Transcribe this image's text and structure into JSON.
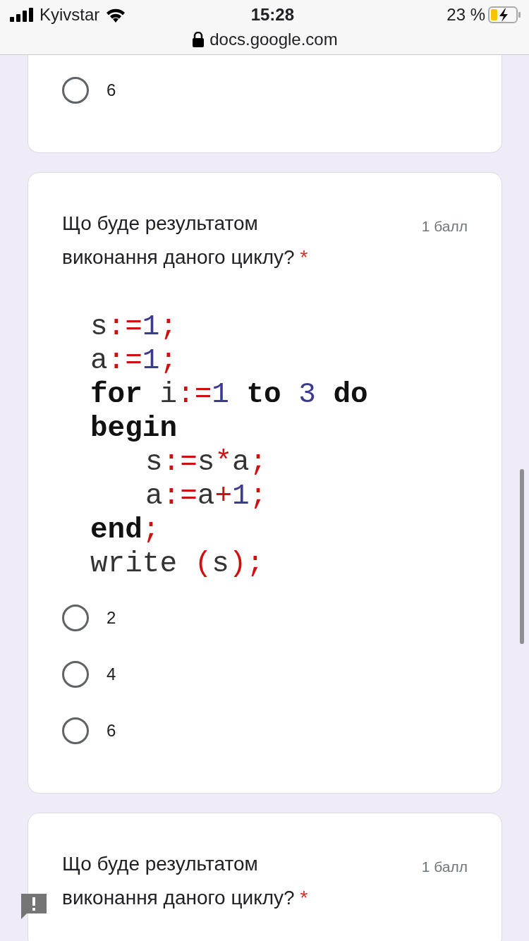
{
  "status_bar": {
    "carrier": "Kyivstar",
    "time": "15:28",
    "battery": "23 %",
    "url": "docs.google.com"
  },
  "questions": [
    {
      "options": [
        {
          "label": "6",
          "selected": false
        }
      ]
    },
    {
      "title": "Що буде результатом виконання даного циклу?",
      "required_mark": "*",
      "points": "1 балл",
      "code": [
        {
          "indented": false,
          "tokens": [
            {
              "kind": "id",
              "text": "s"
            },
            {
              "kind": "op",
              "text": ":="
            },
            {
              "kind": "num",
              "text": "1"
            },
            {
              "kind": "op",
              "text": ";"
            }
          ]
        },
        {
          "indented": false,
          "tokens": [
            {
              "kind": "id",
              "text": "a"
            },
            {
              "kind": "op",
              "text": ":="
            },
            {
              "kind": "num",
              "text": "1"
            },
            {
              "kind": "op",
              "text": ";"
            }
          ]
        },
        {
          "indented": false,
          "tokens": [
            {
              "kind": "kw",
              "text": "for"
            },
            {
              "kind": "id",
              "text": " i"
            },
            {
              "kind": "op",
              "text": ":="
            },
            {
              "kind": "num",
              "text": "1"
            },
            {
              "kind": "kw",
              "text": " to "
            },
            {
              "kind": "num",
              "text": "3"
            },
            {
              "kind": "kw",
              "text": " do"
            }
          ]
        },
        {
          "indented": false,
          "tokens": [
            {
              "kind": "kw",
              "text": "begin"
            }
          ]
        },
        {
          "indented": true,
          "tokens": [
            {
              "kind": "id",
              "text": "s"
            },
            {
              "kind": "op",
              "text": ":="
            },
            {
              "kind": "id",
              "text": "s"
            },
            {
              "kind": "op",
              "text": "*"
            },
            {
              "kind": "id",
              "text": "a"
            },
            {
              "kind": "op",
              "text": ";"
            }
          ]
        },
        {
          "indented": true,
          "tokens": [
            {
              "kind": "id",
              "text": "a"
            },
            {
              "kind": "op",
              "text": ":="
            },
            {
              "kind": "id",
              "text": "a"
            },
            {
              "kind": "op",
              "text": "+"
            },
            {
              "kind": "num",
              "text": "1"
            },
            {
              "kind": "op",
              "text": ";"
            }
          ]
        },
        {
          "indented": false,
          "tokens": [
            {
              "kind": "kw",
              "text": "end"
            },
            {
              "kind": "op",
              "text": ";"
            }
          ]
        },
        {
          "indented": false,
          "tokens": [
            {
              "kind": "id",
              "text": "write "
            },
            {
              "kind": "op",
              "text": "("
            },
            {
              "kind": "id",
              "text": "s"
            },
            {
              "kind": "op",
              "text": ");"
            }
          ]
        }
      ],
      "options": [
        {
          "label": "2",
          "selected": false
        },
        {
          "label": "4",
          "selected": false
        },
        {
          "label": "6",
          "selected": false
        }
      ]
    },
    {
      "title": "Що буде результатом виконання даного циклу?",
      "required_mark": "*",
      "points": "1 балл"
    }
  ]
}
